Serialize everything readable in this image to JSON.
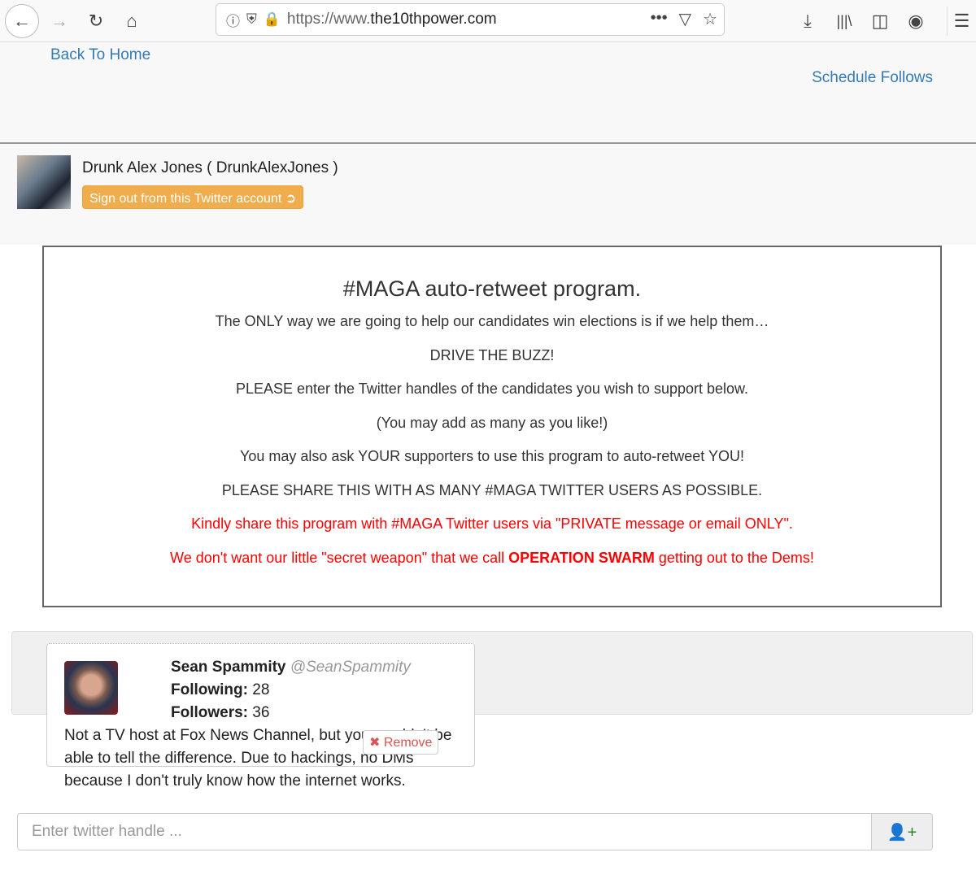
{
  "browser": {
    "url_prefix": "https://www.",
    "url_domain": "the10thpower.com",
    "icons": [
      "back-icon",
      "forward-icon",
      "reload-icon",
      "home-icon",
      "info-icon",
      "shield-icon",
      "lock-icon",
      "more-icon",
      "pocket-icon",
      "star-icon",
      "download-icon",
      "library-icon",
      "sidebar-icon",
      "account-icon",
      "menu-icon"
    ]
  },
  "nav": {
    "back_home": "Back To Home",
    "schedule": "Schedule Follows"
  },
  "account": {
    "name": "Drunk Alex Jones ( DrunkAlexJones )",
    "signout": "Sign out from this Twitter account"
  },
  "program": {
    "title": "#MAGA auto-retweet program.",
    "lines": [
      "The ONLY way we are going to help our candidates win elections is if we help them…",
      "DRIVE THE BUZZ!",
      "PLEASE enter the Twitter handles of the candidates you wish to support below.",
      "(You may add as many as you like!)",
      "You may also ask YOUR supporters to use this program to auto-retweet YOU!",
      "PLEASE SHARE THIS WITH AS MANY #MAGA TWITTER USERS AS POSSIBLE.",
      "Kindly share this program with #MAGA Twitter users via \"PRIVATE message or email ONLY\"."
    ],
    "last_pre": "We don't want our little \"secret weapon\" that we call ",
    "last_bold": "OPERATION SWARM",
    "last_post": " getting out to the Dems!",
    "red_color": "#ff0000"
  },
  "candidate": {
    "name": "Sean Spammity",
    "handle": "@SeanSpammity",
    "following_label": "Following:",
    "following": "28",
    "followers_label": "Followers:",
    "followers": "36",
    "bio": "Not a TV host at Fox News Channel, but you wouldn't be able to tell the difference. Due to hackings, no DMs because I don't truly know how the internet works.",
    "remove": "Remove"
  },
  "add": {
    "placeholder": "Enter twitter handle ...",
    "button_icon": "user-plus-icon",
    "icon_color": "#2e7d32"
  },
  "colors": {
    "link": "#337ab7",
    "signout": "#f0ad4e",
    "remove": "#d9534f"
  }
}
